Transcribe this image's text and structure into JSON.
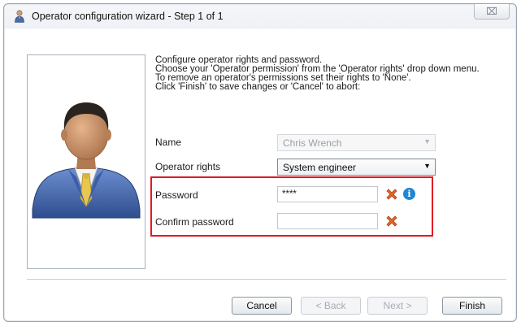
{
  "window": {
    "title": "Operator configuration wizard - Step 1 of 1",
    "close_glyph": "⌧"
  },
  "instructions": [
    "Configure operator rights and password.",
    "Choose your 'Operator permission' from the 'Operator rights' drop down menu.",
    "To remove an operator's permissions set their rights to 'None'.",
    "Click 'Finish' to save changes or 'Cancel' to abort:"
  ],
  "form": {
    "name_label": "Name",
    "name_value": "Chris Wrench",
    "rights_label": "Operator rights",
    "rights_value": "System engineer",
    "password_label": "Password",
    "password_value": "****",
    "confirm_label": "Confirm password",
    "confirm_value": ""
  },
  "icons": {
    "avatar": "user-avatar-icon",
    "error": "error-x-icon",
    "info": "info-icon",
    "info_glyph": "i"
  },
  "buttons": {
    "cancel": "Cancel",
    "back": "< Back",
    "next": "Next >",
    "finish": "Finish"
  },
  "colors": {
    "highlight": "#e01a22",
    "error": "#e3682a",
    "info": "#1d86d6"
  }
}
